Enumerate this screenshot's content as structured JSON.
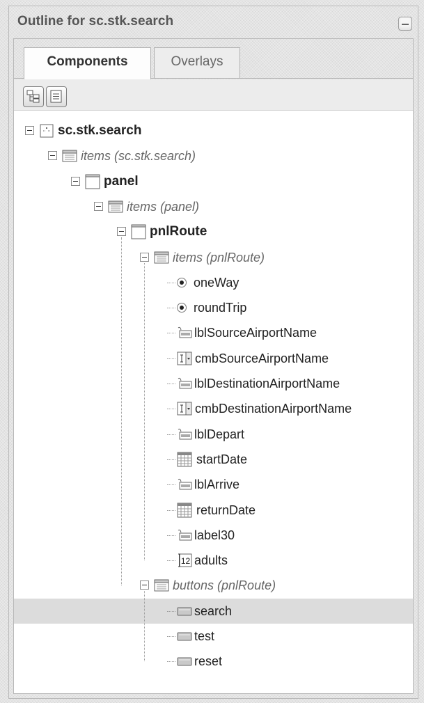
{
  "panel": {
    "title": "Outline for sc.stk.search"
  },
  "tabs": [
    {
      "label": "Components",
      "active": true
    },
    {
      "label": "Overlays",
      "active": false
    }
  ],
  "toolbar": [
    {
      "icon": "tree-expand-icon"
    },
    {
      "icon": "list-view-icon"
    }
  ],
  "tree": [
    {
      "label": "sc.stk.search",
      "icon": "component-icon",
      "style": "bold",
      "expander": true
    },
    {
      "label": "items (sc.stk.search)",
      "icon": "items-group-icon",
      "style": "italic",
      "expander": true
    },
    {
      "label": "panel",
      "icon": "panel-icon",
      "style": "bold",
      "expander": true
    },
    {
      "label": "items (panel)",
      "icon": "items-group-icon",
      "style": "italic",
      "expander": true
    },
    {
      "label": "pnlRoute",
      "icon": "panel-icon",
      "style": "bold",
      "expander": true
    },
    {
      "label": "items (pnlRoute)",
      "icon": "items-group-icon",
      "style": "italic",
      "expander": true
    },
    {
      "label": "oneWay",
      "icon": "radio-icon",
      "style": "normal",
      "expander": false
    },
    {
      "label": "roundTrip",
      "icon": "radio-icon",
      "style": "normal",
      "expander": false
    },
    {
      "label": "lblSourceAirportName",
      "icon": "label-icon",
      "style": "normal",
      "expander": false
    },
    {
      "label": "cmbSourceAirportName",
      "icon": "combobox-icon",
      "style": "normal",
      "expander": false
    },
    {
      "label": "lblDestinationAirportName",
      "icon": "label-icon",
      "style": "normal",
      "expander": false
    },
    {
      "label": "cmbDestinationAirportName",
      "icon": "combobox-icon",
      "style": "normal",
      "expander": false
    },
    {
      "label": "lblDepart",
      "icon": "label-icon",
      "style": "normal",
      "expander": false
    },
    {
      "label": "startDate",
      "icon": "date-field-icon",
      "style": "normal",
      "expander": false
    },
    {
      "label": "lblArrive",
      "icon": "label-icon",
      "style": "normal",
      "expander": false
    },
    {
      "label": "returnDate",
      "icon": "date-field-icon",
      "style": "normal",
      "expander": false
    },
    {
      "label": "label30",
      "icon": "label-icon",
      "style": "normal",
      "expander": false
    },
    {
      "label": "adults",
      "icon": "number-field-icon",
      "icon_text": "12",
      "style": "normal",
      "expander": false
    },
    {
      "label": "buttons (pnlRoute)",
      "icon": "items-group-icon",
      "style": "italic",
      "expander": true
    },
    {
      "label": "search",
      "icon": "button-icon",
      "style": "normal",
      "expander": false,
      "selected": true
    },
    {
      "label": "test",
      "icon": "button-icon",
      "style": "normal",
      "expander": false
    },
    {
      "label": "reset",
      "icon": "button-icon",
      "style": "normal",
      "expander": false
    }
  ]
}
